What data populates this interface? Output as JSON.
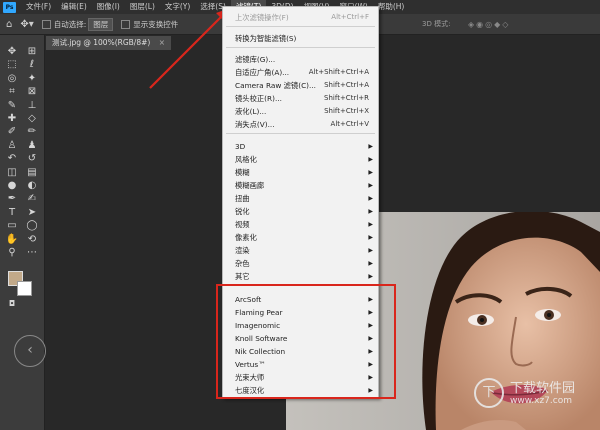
{
  "app": {
    "logo_text": "Ps"
  },
  "menubar": {
    "items": [
      {
        "label": "文件(F)"
      },
      {
        "label": "编辑(E)"
      },
      {
        "label": "图像(I)"
      },
      {
        "label": "图层(L)"
      },
      {
        "label": "文字(Y)"
      },
      {
        "label": "选择(S)"
      },
      {
        "label": "滤镜(T)"
      },
      {
        "label": "3D(D)"
      },
      {
        "label": "视图(V)"
      },
      {
        "label": "窗口(W)"
      },
      {
        "label": "帮助(H)"
      }
    ]
  },
  "options": {
    "auto_select_label": "自动选择:",
    "auto_select_value": "图层",
    "show_transform_label": "显示变换控件",
    "mode_3d_label": "3D 模式:"
  },
  "document": {
    "tab_title": "测试.jpg @ 100%(RGB/8#)",
    "tab_close": "×"
  },
  "tools": [
    {
      "name": "move-tool",
      "glyph": "✥"
    },
    {
      "name": "artboard-tool",
      "glyph": "⊞"
    },
    {
      "name": "marquee-tool",
      "glyph": "⬚"
    },
    {
      "name": "lasso-tool",
      "glyph": "ℓ"
    },
    {
      "name": "quick-select-tool",
      "glyph": "◎"
    },
    {
      "name": "magic-wand-tool",
      "glyph": "✦"
    },
    {
      "name": "crop-tool",
      "glyph": "⌗"
    },
    {
      "name": "frame-tool",
      "glyph": "⊠"
    },
    {
      "name": "eyedropper-tool",
      "glyph": "✎"
    },
    {
      "name": "ruler-tool",
      "glyph": "⊥"
    },
    {
      "name": "healing-brush-tool",
      "glyph": "✚"
    },
    {
      "name": "patch-tool",
      "glyph": "◇"
    },
    {
      "name": "brush-tool",
      "glyph": "✐"
    },
    {
      "name": "pencil-tool",
      "glyph": "✏"
    },
    {
      "name": "clone-stamp-tool",
      "glyph": "♙"
    },
    {
      "name": "pattern-stamp-tool",
      "glyph": "♟"
    },
    {
      "name": "history-brush-tool",
      "glyph": "↶"
    },
    {
      "name": "art-history-tool",
      "glyph": "↺"
    },
    {
      "name": "eraser-tool",
      "glyph": "◫"
    },
    {
      "name": "gradient-tool",
      "glyph": "▤"
    },
    {
      "name": "blur-tool",
      "glyph": "●"
    },
    {
      "name": "dodge-tool",
      "glyph": "◐"
    },
    {
      "name": "pen-tool",
      "glyph": "✒"
    },
    {
      "name": "freeform-pen-tool",
      "glyph": "✍"
    },
    {
      "name": "type-tool",
      "glyph": "T"
    },
    {
      "name": "path-select-tool",
      "glyph": "➤"
    },
    {
      "name": "rectangle-tool",
      "glyph": "▭"
    },
    {
      "name": "ellipse-tool",
      "glyph": "◯"
    },
    {
      "name": "hand-tool",
      "glyph": "✋"
    },
    {
      "name": "rotate-view-tool",
      "glyph": "⟲"
    },
    {
      "name": "zoom-tool",
      "glyph": "⚲"
    },
    {
      "name": "more-tools",
      "glyph": "⋯"
    }
  ],
  "colors": {
    "foreground": "#c2a989",
    "background": "#ffffff",
    "highlight": "#d9261c",
    "canvas_bg": "#282828",
    "menu_bg": "#f2f2f2"
  },
  "nav": {
    "back_glyph": "‹"
  },
  "filter_menu": {
    "last_filter": {
      "label": "上次滤镜操作(F)",
      "shortcut": "Alt+Ctrl+F"
    },
    "convert_smart": {
      "label": "转换为智能滤镜(S)"
    },
    "plugins": [
      {
        "label": "滤镜库(G)...",
        "shortcut": ""
      },
      {
        "label": "自适应广角(A)...",
        "shortcut": "Alt+Shift+Ctrl+A"
      },
      {
        "label": "Camera Raw 滤镜(C)...",
        "shortcut": "Shift+Ctrl+A"
      },
      {
        "label": "镜头校正(R)...",
        "shortcut": "Shift+Ctrl+R"
      },
      {
        "label": "液化(L)...",
        "shortcut": "Shift+Ctrl+X"
      },
      {
        "label": "消失点(V)...",
        "shortcut": "Alt+Ctrl+V"
      }
    ],
    "categories": [
      {
        "label": "3D"
      },
      {
        "label": "风格化"
      },
      {
        "label": "模糊"
      },
      {
        "label": "模糊画廊"
      },
      {
        "label": "扭曲"
      },
      {
        "label": "锐化"
      },
      {
        "label": "视频"
      },
      {
        "label": "像素化"
      },
      {
        "label": "渲染"
      },
      {
        "label": "杂色"
      },
      {
        "label": "其它"
      }
    ],
    "third_party": [
      {
        "label": "ArcSoft"
      },
      {
        "label": "Flaming Pear"
      },
      {
        "label": "Imagenomic"
      },
      {
        "label": "Knoll Software"
      },
      {
        "label": "Nik Collection"
      },
      {
        "label": "Vertus™"
      },
      {
        "label": "光束大师"
      },
      {
        "label": "七度汉化"
      }
    ]
  },
  "watermark": {
    "symbol": "下",
    "title": "下载软件园",
    "url": "www.xz7.com"
  }
}
